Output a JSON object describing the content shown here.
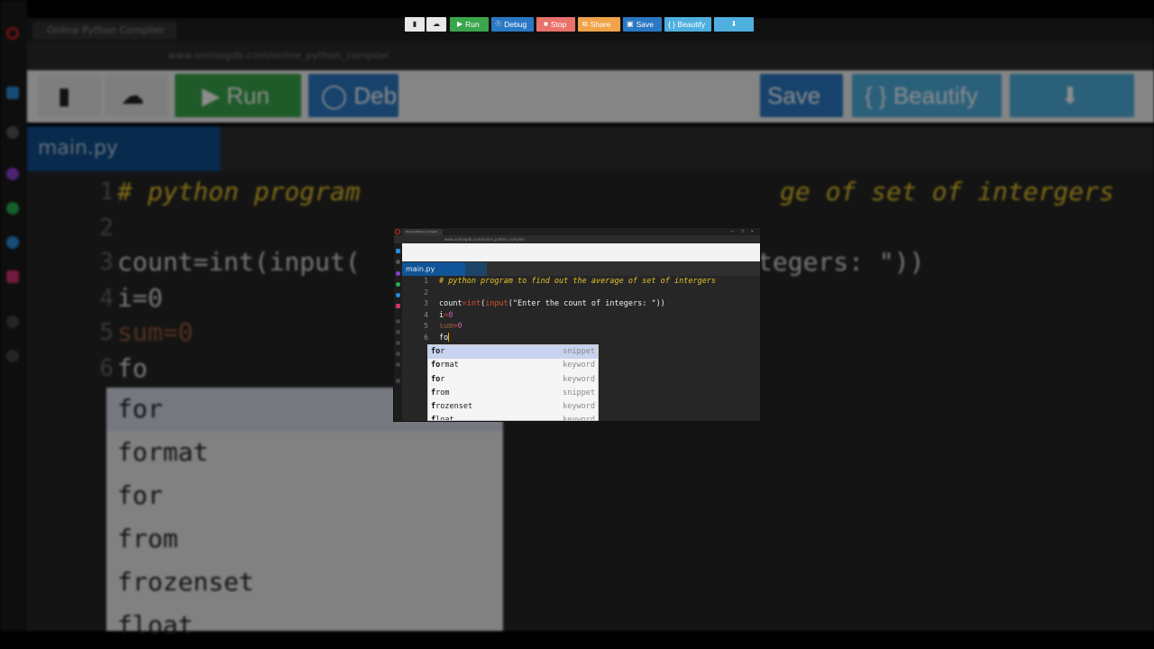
{
  "browser": {
    "tab_title": "Online Python Compiler",
    "address": "www.onlinegdb.com/online_python_compiler",
    "window_controls": "— ❐ ✕"
  },
  "toolbar": {
    "new_icon": "file-icon",
    "upload_icon": "upload-cloud-icon",
    "run_label": "Run",
    "debug_label": "Debug",
    "stop_label": "Stop",
    "share_label": "Share",
    "save_label": "Save",
    "beautify_label": "{ } Beautify",
    "download_icon": "download-icon",
    "colors": {
      "run": "#3aa64c",
      "debug": "#2b78c4",
      "stop": "#e8726c",
      "share": "#f0a34a",
      "save": "#2b78c4",
      "beautify": "#4fb0e0",
      "download": "#4fb0e0"
    }
  },
  "file_tab": {
    "name": "main.py"
  },
  "editor": {
    "line_numbers": [
      "1",
      "2",
      "3",
      "4",
      "5",
      "6"
    ],
    "line1": "# python program to find out the average of set of intergers",
    "line3": {
      "var": "count",
      "eq": "=",
      "f1": "int",
      "p1": "(",
      "f2": "input",
      "p2": "(",
      "str": "\"Enter the count of integers: \"",
      "close": "))"
    },
    "line4": {
      "var": "i",
      "eq": "=",
      "val": "0"
    },
    "line5": {
      "var": "sum",
      "eq": "=",
      "val": "0"
    },
    "line6": "fo"
  },
  "autocomplete": {
    "items": [
      {
        "match": "fo",
        "rest": "r",
        "kind": "snippet"
      },
      {
        "match": "fo",
        "rest": "rmat",
        "kind": "keyword"
      },
      {
        "match": "fo",
        "rest": "r",
        "kind": "keyword"
      },
      {
        "match": "f",
        "rest": "rom",
        "kind": "snippet"
      },
      {
        "match": "f",
        "rest": "rozenset",
        "kind": "keyword"
      },
      {
        "match": "f",
        "rest": "loat",
        "kind": "keyword"
      }
    ]
  },
  "background": {
    "run_label": "Run",
    "debug_label": "Deb",
    "save_label": "Save",
    "beautify_label": "{ } Beautify",
    "file_tab": "main.py",
    "line1_left": "# python program",
    "line1_right": "ge of set of intergers",
    "line3_left": "count=int(input(",
    "line3_right": "tegers: \"))",
    "line4": "i=0",
    "line5": "sum=0",
    "line6": "fo",
    "auto_items": [
      "for",
      "format",
      "for",
      "from",
      "frozenset",
      "float"
    ]
  }
}
